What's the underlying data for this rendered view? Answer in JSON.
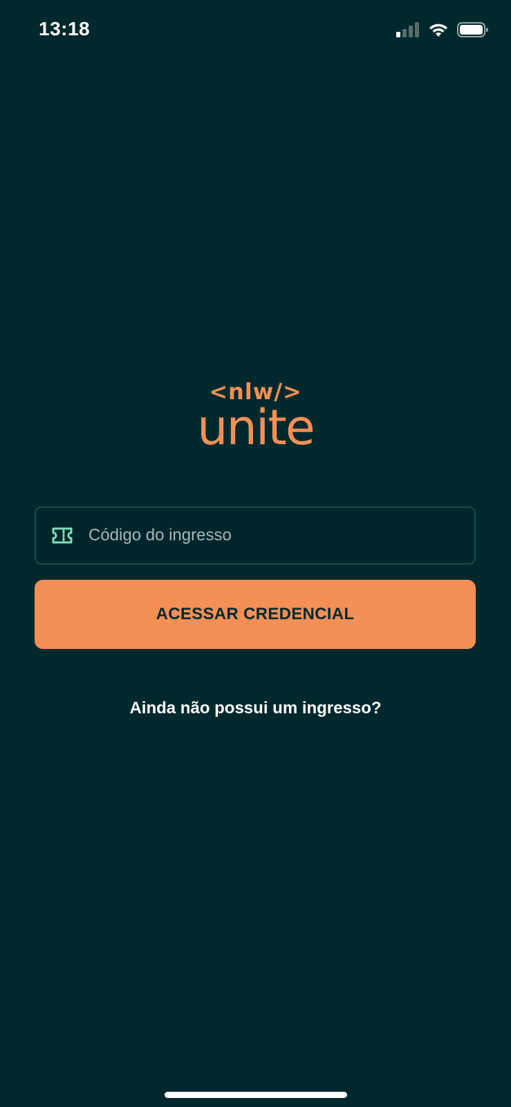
{
  "status_bar": {
    "time": "13:18",
    "icons": [
      "signal-icon",
      "wifi-icon",
      "battery-icon"
    ]
  },
  "logo": {
    "top_text": "<nlw/>",
    "main_text": "unite",
    "color": "#f48f56"
  },
  "form": {
    "ticket_code": {
      "placeholder": "Código do ingresso",
      "value": "",
      "icon": "ticket-icon",
      "icon_color": "#7ce0b9"
    },
    "submit_label": "ACESSAR CREDENCIAL"
  },
  "footer_link": "Ainda não possui um ingresso?",
  "colors": {
    "background": "#00292e",
    "accent": "#f48f56",
    "text": "#ffffff"
  }
}
